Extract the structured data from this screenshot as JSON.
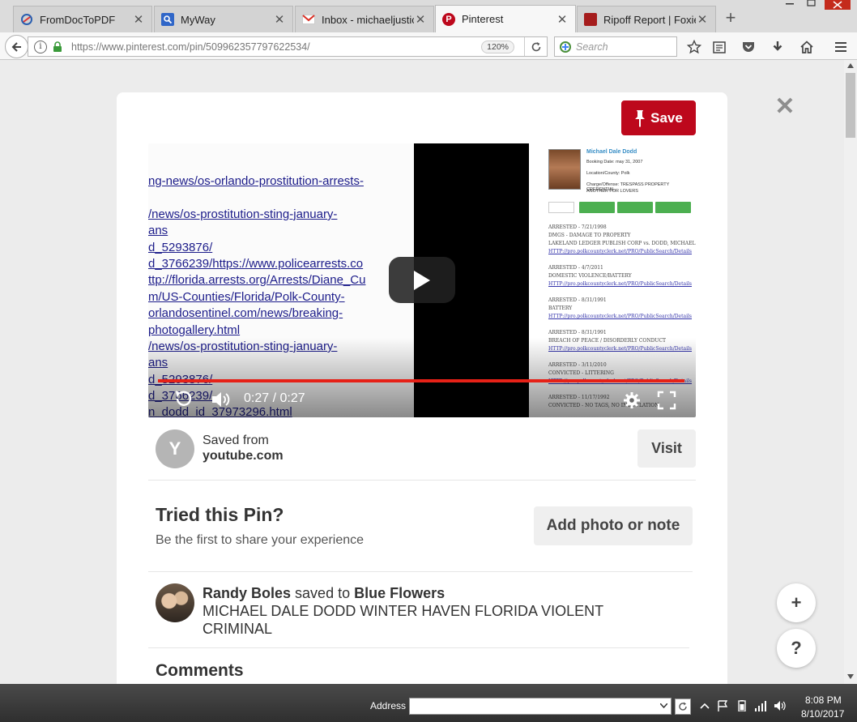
{
  "browser": {
    "tabs": [
      {
        "title": "FromDocToPDF",
        "active": false
      },
      {
        "title": "MyWay",
        "active": false
      },
      {
        "title": "Inbox - michaeljustic",
        "active": false
      },
      {
        "title": "Pinterest",
        "active": true
      },
      {
        "title": "Ripoff Report | Foxies",
        "active": false
      }
    ],
    "new_tab": "+",
    "url": "https://www.pinterest.com/pin/509962357797622534/",
    "zoom": "120%",
    "search_placeholder": "Search"
  },
  "pin": {
    "save_label": "Save",
    "close": "✕",
    "video": {
      "left_lines": [
        {
          "text": "ng-news/os-orlando-prostitution-arrests-",
          "link": true
        },
        {
          "text": "/news/os-prostitution-sting-january-",
          "link": true
        },
        {
          "text": "ans",
          "link": true
        },
        {
          "text": "d_5293876/",
          "link": true
        },
        {
          "text": "d_3766239/https://www.policearrests.co",
          "link": true
        },
        {
          "text": "ttp://florida.arrests.org/Arrests/Diane_Cu",
          "link": true
        },
        {
          "text": "m/US-Counties/Florida/Polk-County-",
          "link": true
        },
        {
          "text": "orlandosentinel.com/news/breaking-",
          "link": true
        },
        {
          "text": "photogallery.html",
          "link": true
        },
        {
          "text": "/news/os-prostitution-sting-january-",
          "link": true
        },
        {
          "text": "ans",
          "link": true
        },
        {
          "text": "d_5293876/",
          "link": true
        },
        {
          "text": "d_3766239/",
          "link": true
        },
        {
          "text": "n_dodd_id_37973296.html",
          "link": true
        }
      ],
      "doc_name": "Michael Dale Dodd",
      "doc_meta": [
        "Booking Date: may 31, 2007",
        "Location/County: Polk",
        "Charge/Offense: TRESPASS PROPERTY CREDENTIAL",
        "ANOTHER FOR LOVERS"
      ],
      "doc_lines": [
        {
          "text": "ARRESTED - 7/21/1998",
          "link": false
        },
        {
          "text": "DMGS - DAMAGE TO PROPERTY",
          "link": false
        },
        {
          "text": "LAKELAND LEDGER PUBLISH CORP vs. DODD, MICHAEL",
          "link": false
        },
        {
          "text": "HTTP://pro.polkcountyclerk.net/PRO/PublicSearch/Details",
          "link": true
        },
        {
          "text": "ARRESTED - 4/7/2011",
          "link": false
        },
        {
          "text": "DOMESTIC VIOLENCE/BATTERY",
          "link": false
        },
        {
          "text": "HTTP://pro.polkcountyclerk.net/PRO/PublicSearch/Details",
          "link": true
        },
        {
          "text": "ARRESTED - 8/31/1991",
          "link": false
        },
        {
          "text": "BATTERY",
          "link": false
        },
        {
          "text": "HTTP://pro.polkcountyclerk.net/PRO/PublicSearch/Details",
          "link": true
        },
        {
          "text": "ARRESTED - 8/31/1991",
          "link": false
        },
        {
          "text": "BREACH OF PEACE / DISORDERLY CONDUCT",
          "link": false
        },
        {
          "text": "HTTP://pro.polkcountyclerk.net/PRO/PublicSearch/Details",
          "link": true
        },
        {
          "text": "ARRESTED - 3/11/2010",
          "link": false
        },
        {
          "text": "CONVICTED - LITTERING",
          "link": false
        },
        {
          "text": "HTTP://pro.polkcountyclerk.net/PRO/PublicSearch/Details",
          "link": true
        },
        {
          "text": "ARRESTED - 11/17/1992",
          "link": false
        },
        {
          "text": "CONVICTED - NO TAGS, NO INOCULATION",
          "link": false
        }
      ],
      "time": "0:27 / 0:27",
      "progress": 1.0
    },
    "source": {
      "avatar_letter": "Y",
      "saved_from": "Saved from",
      "domain": "youtube.com",
      "visit_label": "Visit"
    },
    "tried": {
      "title": "Tried this Pin?",
      "subtitle": "Be the first to share your experience",
      "button": "Add photo or note"
    },
    "saver": {
      "name": "Randy Boles",
      "saved_to": "saved to",
      "board": "Blue Flowers",
      "description": "MICHAEL DALE DODD WINTER HAVEN FLORIDA VIOLENT CRIMINAL"
    },
    "comments_title": "Comments",
    "fab_plus": "+",
    "fab_help": "?"
  },
  "taskbar": {
    "address_label": "Address",
    "address_value": "",
    "time": "8:08 PM",
    "date": "8/10/2017"
  },
  "colors": {
    "pinterest_red": "#bd081c",
    "progress_red": "#e62117"
  },
  "icons": [
    "back-arrow-icon",
    "info-icon",
    "lock-icon",
    "reload-icon",
    "google-search-icon",
    "bookmark-star-icon",
    "reading-list-icon",
    "pocket-icon",
    "download-icon",
    "home-icon",
    "hamburger-menu-icon",
    "pin-icon",
    "play-icon",
    "replay-icon",
    "volume-icon",
    "gear-icon",
    "fullscreen-icon"
  ]
}
